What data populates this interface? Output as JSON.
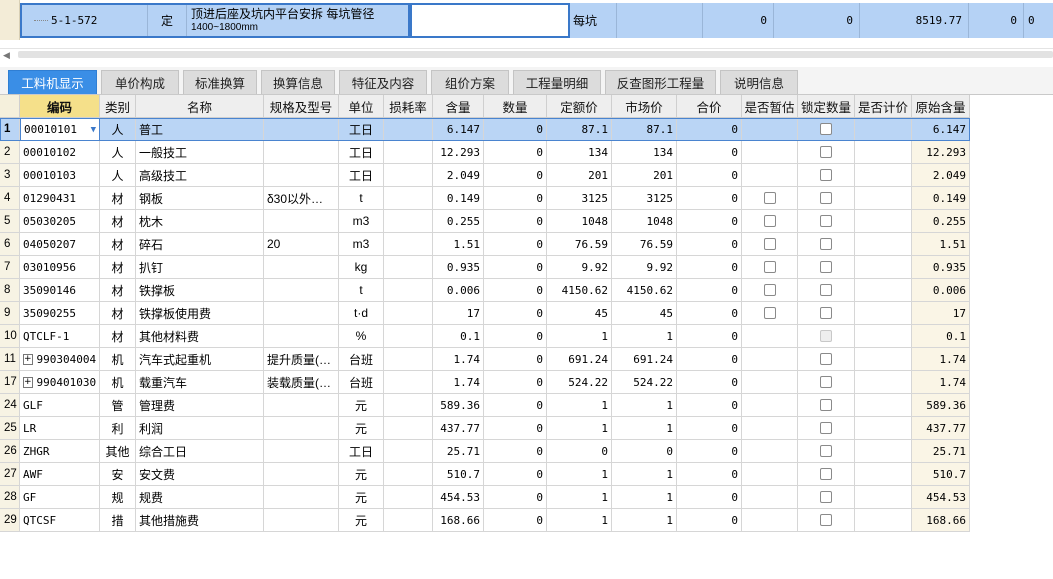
{
  "quota_row": {
    "code": "5-1-572",
    "type": "定",
    "name_line1": "顶进后座及坑内平台安拆 每坑管径",
    "name_line2": "1400~1800mm",
    "unit": "每坑",
    "val1": "0",
    "val2": "0",
    "val3": "8519.77",
    "val4": "0",
    "val5": "0"
  },
  "tabs": [
    {
      "label": "工料机显示",
      "active": true
    },
    {
      "label": "单价构成",
      "active": false
    },
    {
      "label": "标准换算",
      "active": false
    },
    {
      "label": "换算信息",
      "active": false
    },
    {
      "label": "特征及内容",
      "active": false
    },
    {
      "label": "组价方案",
      "active": false
    },
    {
      "label": "工程量明细",
      "active": false
    },
    {
      "label": "反查图形工程量",
      "active": false
    },
    {
      "label": "说明信息",
      "active": false
    }
  ],
  "columns": {
    "code": "编码",
    "type": "类别",
    "name": "名称",
    "spec": "规格及型号",
    "unit": "单位",
    "loss": "损耗率",
    "content": "含量",
    "qty": "数量",
    "quota_price": "定额价",
    "market_price": "市场价",
    "total": "合价",
    "provisional": "是否暂估",
    "lock_qty": "锁定数量",
    "count_price": "是否计价",
    "orig_content": "原始含量"
  },
  "rows": [
    {
      "idx": "1",
      "code": "00010101",
      "type": "人",
      "name": "普工",
      "spec": "",
      "unit": "工日",
      "content": "6.147",
      "qty": "0",
      "quota_price": "87.1",
      "market_price": "87.1",
      "total": "0",
      "provisional": "",
      "lock": "box",
      "orig": "6.147",
      "expand": false
    },
    {
      "idx": "2",
      "code": "00010102",
      "type": "人",
      "name": "一般技工",
      "spec": "",
      "unit": "工日",
      "content": "12.293",
      "qty": "0",
      "quota_price": "134",
      "market_price": "134",
      "total": "0",
      "provisional": "",
      "lock": "box",
      "orig": "12.293",
      "expand": false
    },
    {
      "idx": "3",
      "code": "00010103",
      "type": "人",
      "name": "高级技工",
      "spec": "",
      "unit": "工日",
      "content": "2.049",
      "qty": "0",
      "quota_price": "201",
      "market_price": "201",
      "total": "0",
      "provisional": "",
      "lock": "box",
      "orig": "2.049",
      "expand": false
    },
    {
      "idx": "4",
      "code": "01290431",
      "type": "材",
      "name": "钢板",
      "spec": "δ30以外…",
      "unit": "t",
      "content": "0.149",
      "qty": "0",
      "quota_price": "3125",
      "market_price": "3125",
      "total": "0",
      "provisional": "box",
      "lock": "box",
      "orig": "0.149",
      "expand": false
    },
    {
      "idx": "5",
      "code": "05030205",
      "type": "材",
      "name": "枕木",
      "spec": "",
      "unit": "m3",
      "content": "0.255",
      "qty": "0",
      "quota_price": "1048",
      "market_price": "1048",
      "total": "0",
      "provisional": "box",
      "lock": "box",
      "orig": "0.255",
      "expand": false
    },
    {
      "idx": "6",
      "code": "04050207",
      "type": "材",
      "name": "碎石",
      "spec": "20",
      "unit": "m3",
      "content": "1.51",
      "qty": "0",
      "quota_price": "76.59",
      "market_price": "76.59",
      "total": "0",
      "provisional": "box",
      "lock": "box",
      "orig": "1.51",
      "expand": false
    },
    {
      "idx": "7",
      "code": "03010956",
      "type": "材",
      "name": "扒钉",
      "spec": "",
      "unit": "kg",
      "content": "0.935",
      "qty": "0",
      "quota_price": "9.92",
      "market_price": "9.92",
      "total": "0",
      "provisional": "box",
      "lock": "box",
      "orig": "0.935",
      "expand": false
    },
    {
      "idx": "8",
      "code": "35090146",
      "type": "材",
      "name": "铁撑板",
      "spec": "",
      "unit": "t",
      "content": "0.006",
      "qty": "0",
      "quota_price": "4150.62",
      "market_price": "4150.62",
      "total": "0",
      "provisional": "box",
      "lock": "box",
      "orig": "0.006",
      "expand": false
    },
    {
      "idx": "9",
      "code": "35090255",
      "type": "材",
      "name": "铁撑板使用费",
      "spec": "",
      "unit": "t·d",
      "content": "17",
      "qty": "0",
      "quota_price": "45",
      "market_price": "45",
      "total": "0",
      "provisional": "box",
      "lock": "box",
      "orig": "17",
      "expand": false
    },
    {
      "idx": "10",
      "code": "QTCLF-1",
      "type": "材",
      "name": "其他材料费",
      "spec": "",
      "unit": "%",
      "content": "0.1",
      "qty": "0",
      "quota_price": "1",
      "market_price": "1",
      "total": "0",
      "provisional": "",
      "lock": "dis",
      "orig": "0.1",
      "expand": false
    },
    {
      "idx": "11",
      "code": "990304004",
      "type": "机",
      "name": "汽车式起重机",
      "spec": "提升质量(…",
      "unit": "台班",
      "content": "1.74",
      "qty": "0",
      "quota_price": "691.24",
      "market_price": "691.24",
      "total": "0",
      "provisional": "",
      "lock": "box",
      "orig": "1.74",
      "expand": true
    },
    {
      "idx": "17",
      "code": "990401030",
      "type": "机",
      "name": "载重汽车",
      "spec": "装载质量(…",
      "unit": "台班",
      "content": "1.74",
      "qty": "0",
      "quota_price": "524.22",
      "market_price": "524.22",
      "total": "0",
      "provisional": "",
      "lock": "box",
      "orig": "1.74",
      "expand": true
    },
    {
      "idx": "24",
      "code": "GLF",
      "type": "管",
      "name": "管理费",
      "spec": "",
      "unit": "元",
      "content": "589.36",
      "qty": "0",
      "quota_price": "1",
      "market_price": "1",
      "total": "0",
      "provisional": "",
      "lock": "box",
      "orig": "589.36",
      "expand": false
    },
    {
      "idx": "25",
      "code": "LR",
      "type": "利",
      "name": "利润",
      "spec": "",
      "unit": "元",
      "content": "437.77",
      "qty": "0",
      "quota_price": "1",
      "market_price": "1",
      "total": "0",
      "provisional": "",
      "lock": "box",
      "orig": "437.77",
      "expand": false
    },
    {
      "idx": "26",
      "code": "ZHGR",
      "type": "其他",
      "name": "综合工日",
      "spec": "",
      "unit": "工日",
      "content": "25.71",
      "qty": "0",
      "quota_price": "0",
      "market_price": "0",
      "total": "0",
      "provisional": "",
      "lock": "box",
      "orig": "25.71",
      "expand": false
    },
    {
      "idx": "27",
      "code": "AWF",
      "type": "安",
      "name": "安文费",
      "spec": "",
      "unit": "元",
      "content": "510.7",
      "qty": "0",
      "quota_price": "1",
      "market_price": "1",
      "total": "0",
      "provisional": "",
      "lock": "box",
      "orig": "510.7",
      "expand": false
    },
    {
      "idx": "28",
      "code": "GF",
      "type": "规",
      "name": "规费",
      "spec": "",
      "unit": "元",
      "content": "454.53",
      "qty": "0",
      "quota_price": "1",
      "market_price": "1",
      "total": "0",
      "provisional": "",
      "lock": "box",
      "orig": "454.53",
      "expand": false
    },
    {
      "idx": "29",
      "code": "QTCSF",
      "type": "措",
      "name": "其他措施费",
      "spec": "",
      "unit": "元",
      "content": "168.66",
      "qty": "0",
      "quota_price": "1",
      "market_price": "1",
      "total": "0",
      "provisional": "",
      "lock": "box",
      "orig": "168.66",
      "expand": false
    }
  ]
}
